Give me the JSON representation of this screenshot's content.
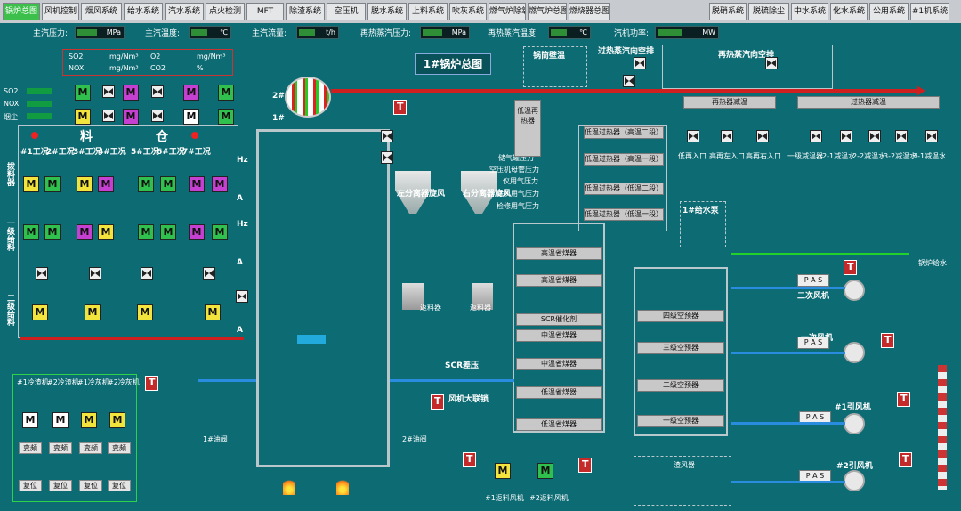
{
  "nav": {
    "left": [
      "锅炉总图",
      "风机控制",
      "烟风系统",
      "给水系统",
      "汽水系统",
      "点火检测",
      "MFT",
      "除渣系统",
      "空压机",
      "脱水系统",
      "上料系统",
      "吹灰系统",
      "燃气炉除氧器",
      "燃气炉总图",
      "燃烧器总图"
    ],
    "right": [
      "脱硝系统",
      "脱硫除尘",
      "中水系统",
      "化水系统",
      "公用系统",
      "#1机系统"
    ]
  },
  "status": [
    {
      "label": "主汽压力:",
      "unit": "MPa"
    },
    {
      "label": "主汽温度:",
      "unit": "℃"
    },
    {
      "label": "主汽流量:",
      "unit": "t/h"
    },
    {
      "label": "再热蒸汽压力:",
      "unit": "MPa"
    },
    {
      "label": "再热蒸汽温度:",
      "unit": "℃"
    },
    {
      "label": "汽机功率:",
      "unit": "MW"
    }
  ],
  "title": "1#锅炉总图",
  "emissions": {
    "so2": "SO2",
    "nox": "NOX",
    "o2": "O2",
    "co2": "CO2",
    "unit1": "mg/Nm³",
    "unit2": "%"
  },
  "left_panel": {
    "so2": "SO2",
    "nox": "NOX",
    "dust": "烟尘",
    "material": "料",
    "bin": "仓",
    "outlets": [
      "#1工况",
      "2#工况",
      "3#工况",
      "4#工况",
      "5#工况",
      "6#工况",
      "7#工况"
    ],
    "side1": "拨料器",
    "side2": "一级给料",
    "side3": "二级给料",
    "hz": "Hz",
    "amp": "A"
  },
  "drum": {
    "num2": "2#",
    "num1": "1#"
  },
  "cyclones": {
    "left": "左分离器旋风",
    "right": "右分离器旋风"
  },
  "preheater_title": "锅筒壁温",
  "desuper_title": "过热蒸汽向空排",
  "reheat_title": "再热蒸汽向空排",
  "low_temp": "低温再热器",
  "superheaters": [
    "低温过热器（高温二段）",
    "低温过热器（高温一段）",
    "低温过热器（低温二段）",
    "低温过热器（低温一段）"
  ],
  "pressures": [
    "储气罐压力",
    "空压机母管压力",
    "仪用气压力",
    "除灰用气压力",
    "检修用气压力"
  ],
  "economizers": [
    "高温省煤器",
    "高温省煤器",
    "SCR催化剂",
    "中温省煤器",
    "中温省煤器",
    "低温省煤器",
    "低温省煤器"
  ],
  "air_heaters": [
    "四级空预器",
    "三级空预器",
    "二级空预器",
    "一级空预器"
  ],
  "scr_label": "SCR差压",
  "wind_interlock": "风机大联锁",
  "reheater_temp": "再热器减温",
  "superheater_temp": "过热器减温",
  "desuper_valves": [
    "低再入口",
    "高再左入口",
    "高再右入口",
    "一级减温器",
    "2-1减温水",
    "2-2减温水",
    "3-2减温水",
    "3-1减温水"
  ],
  "feedpump": "1#给水泵",
  "boiler_feed": "锅炉给水",
  "fans": [
    "二次风机",
    "一次风机",
    "#1引风机",
    "#2引风机"
  ],
  "pas": "P A S",
  "bottom_fans": [
    "#1返料风机",
    "#2返料风机"
  ],
  "ash_items": [
    "#1冷渣机",
    "#2冷渣机",
    "#1冷灰机",
    "#2冷灰机"
  ],
  "ash_btn1": "变频",
  "ash_btn2": "复位",
  "oil_valves": [
    "1#油阀",
    "2#油阀"
  ],
  "bottom_ash": "渣风器",
  "fans_small": [
    "返料风机"
  ],
  "silos": [
    "返料器",
    "返料器"
  ]
}
